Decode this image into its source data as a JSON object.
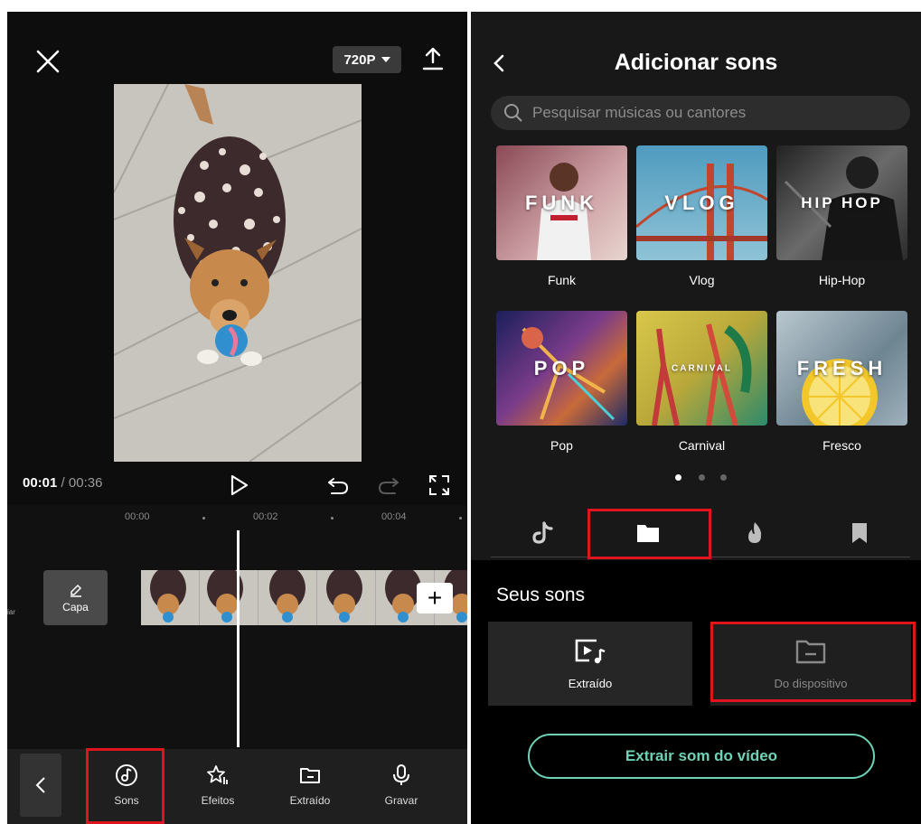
{
  "left_panel": {
    "resolution": "720P",
    "time_current": "00:01",
    "time_total": "/ 00:36",
    "ruler": [
      "00:00",
      "00:02",
      "00:04"
    ],
    "cover_label": "Capa",
    "left_edge_label": "iar",
    "toolbar": [
      {
        "label": "Sons",
        "icon": "music-note-icon"
      },
      {
        "label": "Efeitos",
        "icon": "effects-star-icon"
      },
      {
        "label": "Extraído",
        "icon": "folder-icon"
      },
      {
        "label": "Gravar",
        "icon": "microphone-icon"
      }
    ]
  },
  "right_panel": {
    "title": "Adicionar sons",
    "search_placeholder": "Pesquisar músicas ou cantores",
    "genres": [
      {
        "thumb_text": "FUNK",
        "label": "Funk",
        "color": "#b06a73"
      },
      {
        "thumb_text": "VLOG",
        "label": "Vlog",
        "color": "#5d9fb8"
      },
      {
        "thumb_text": "HIP HOP",
        "label": "Hip-Hop",
        "color": "#3a3a3a"
      },
      {
        "thumb_text": "POP",
        "label": "Pop",
        "color": "#2a2f6e"
      },
      {
        "thumb_text": "CARNIVAL",
        "label": "Carnival",
        "color": "#c9b740"
      },
      {
        "thumb_text": "FRESH",
        "label": "Fresco",
        "color": "#8fa3b0"
      }
    ],
    "carousel_page": 1,
    "carousel_pages": 3,
    "tabs": [
      "tiktok-icon",
      "folder-icon",
      "fire-icon",
      "bookmark-icon"
    ],
    "section_title": "Seus sons",
    "sources": [
      {
        "label": "Extraído",
        "icon": "video-music-icon"
      },
      {
        "label": "Do dispositivo",
        "icon": "folder-icon"
      }
    ],
    "extract_button": "Extrair som do vídeo"
  },
  "colors": {
    "highlight": "#e0141e",
    "accent": "#6fd2b6"
  }
}
